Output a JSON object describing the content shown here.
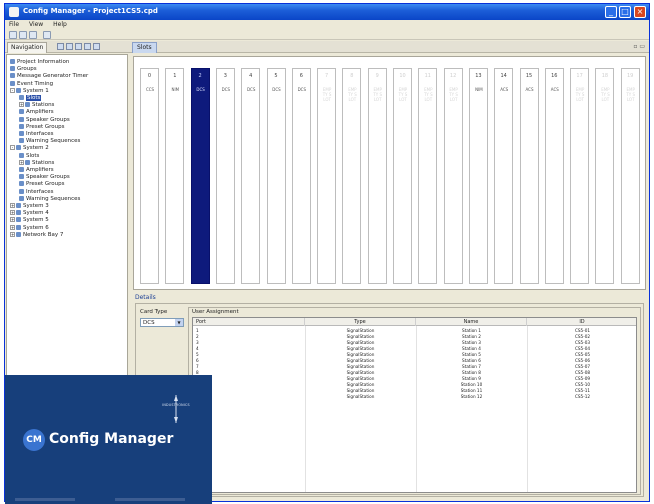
{
  "window": {
    "title": "Config Manager - Project1CS5.cpd"
  },
  "menu": [
    "File",
    "View",
    "Help"
  ],
  "nav_tab": {
    "label": "Navigation"
  },
  "doc_tab": {
    "label": "Slots"
  },
  "tree": [
    {
      "label": "Project Information",
      "level": 0,
      "icon": "info"
    },
    {
      "label": "Groups",
      "level": 0,
      "icon": "groups"
    },
    {
      "label": "Message Generator Timer",
      "level": 0,
      "icon": "timer"
    },
    {
      "label": "Event Timing",
      "level": 0,
      "icon": "timing"
    },
    {
      "label": "System 1",
      "level": 0,
      "icon": "system",
      "expander": "-"
    },
    {
      "label": "Slots",
      "level": 1,
      "icon": "slots",
      "selected": true
    },
    {
      "label": "Stations",
      "level": 1,
      "icon": "stations",
      "expander": "+"
    },
    {
      "label": "Amplifiers",
      "level": 1,
      "icon": "amplifiers"
    },
    {
      "label": "Speaker Groups",
      "level": 1,
      "icon": "speakers"
    },
    {
      "label": "Preset Groups",
      "level": 1,
      "icon": "presets"
    },
    {
      "label": "Interfaces",
      "level": 1,
      "icon": "interfaces"
    },
    {
      "label": "Warning Sequences",
      "level": 1,
      "icon": "warning"
    },
    {
      "label": "System 2",
      "level": 0,
      "icon": "system",
      "expander": "-"
    },
    {
      "label": "Slots",
      "level": 1,
      "icon": "slots"
    },
    {
      "label": "Stations",
      "level": 1,
      "icon": "stations",
      "expander": "+"
    },
    {
      "label": "Amplifiers",
      "level": 1,
      "icon": "amplifiers"
    },
    {
      "label": "Speaker Groups",
      "level": 1,
      "icon": "speakers"
    },
    {
      "label": "Preset Groups",
      "level": 1,
      "icon": "presets"
    },
    {
      "label": "Interfaces",
      "level": 1,
      "icon": "interfaces"
    },
    {
      "label": "Warning Sequences",
      "level": 1,
      "icon": "warning"
    },
    {
      "label": "System 3",
      "level": 0,
      "icon": "system",
      "expander": "+"
    },
    {
      "label": "System 4",
      "level": 0,
      "icon": "system",
      "expander": "+"
    },
    {
      "label": "System 5",
      "level": 0,
      "icon": "system",
      "expander": "+"
    },
    {
      "label": "System 6",
      "level": 0,
      "icon": "system",
      "expander": "+"
    },
    {
      "label": "Network Bay 7",
      "level": 0,
      "icon": "system",
      "expander": "+"
    }
  ],
  "slots": [
    {
      "num": "0",
      "name": "CCS",
      "state": "normal"
    },
    {
      "num": "1",
      "name": "NIM",
      "state": "normal"
    },
    {
      "num": "2",
      "name": "DCS",
      "state": "selected"
    },
    {
      "num": "3",
      "name": "DCS",
      "state": "normal"
    },
    {
      "num": "4",
      "name": "DCS",
      "state": "normal"
    },
    {
      "num": "5",
      "name": "DCS",
      "state": "normal"
    },
    {
      "num": "6",
      "name": "DCS",
      "state": "normal"
    },
    {
      "num": "7",
      "name": "EMPTY SLOT",
      "state": "empty"
    },
    {
      "num": "8",
      "name": "EMPTY SLOT",
      "state": "empty"
    },
    {
      "num": "9",
      "name": "EMPTY SLOT",
      "state": "empty"
    },
    {
      "num": "10",
      "name": "EMPTY SLOT",
      "state": "empty"
    },
    {
      "num": "11",
      "name": "EMPTY SLOT",
      "state": "empty"
    },
    {
      "num": "12",
      "name": "EMPTY SLOT",
      "state": "empty"
    },
    {
      "num": "13",
      "name": "NIM",
      "state": "normal"
    },
    {
      "num": "14",
      "name": "ACS",
      "state": "normal"
    },
    {
      "num": "15",
      "name": "ACS",
      "state": "normal"
    },
    {
      "num": "16",
      "name": "ACS",
      "state": "normal"
    },
    {
      "num": "17",
      "name": "EMPTY SLOT",
      "state": "empty"
    },
    {
      "num": "18",
      "name": "EMPTY SLOT",
      "state": "empty"
    },
    {
      "num": "19",
      "name": "EMPTY SLOT",
      "state": "empty"
    }
  ],
  "details": {
    "header": "Details",
    "card_type_label": "Card Type",
    "card_type_value": "DCS",
    "user_assignment_label": "User Assignment",
    "columns": [
      "Port",
      "Type",
      "Name",
      "ID"
    ],
    "rows": [
      [
        "1",
        "SignalStation",
        "Station 1",
        "CS5-01"
      ],
      [
        "2",
        "SignalStation",
        "Station 2",
        "CS5-02"
      ],
      [
        "3",
        "SignalStation",
        "Station 3",
        "CS5-03"
      ],
      [
        "4",
        "SignalStation",
        "Station 4",
        "CS5-04"
      ],
      [
        "5",
        "SignalStation",
        "Station 5",
        "CS5-05"
      ],
      [
        "6",
        "SignalStation",
        "Station 6",
        "CS5-06"
      ],
      [
        "7",
        "SignalStation",
        "Station 7",
        "CS5-07"
      ],
      [
        "8",
        "SignalStation",
        "Station 8",
        "CS5-08"
      ],
      [
        "9",
        "SignalStation",
        "Station 9",
        "CS5-09"
      ],
      [
        "10",
        "SignalStation",
        "Station 10",
        "CS5-10"
      ],
      [
        "11",
        "SignalStation",
        "Station 11",
        "CS5-11"
      ],
      [
        "12",
        "SignalStation",
        "Station 12",
        "CS5-12"
      ]
    ]
  },
  "splash": {
    "badge": "CM",
    "product": "Config Manager",
    "brand": "INDUSTRONICS"
  },
  "colors": {
    "titlebar": "#0a45c7",
    "selected_slot": "#0e1a7c",
    "splash_bg": "#173f7b",
    "badge": "#3a74d0"
  }
}
